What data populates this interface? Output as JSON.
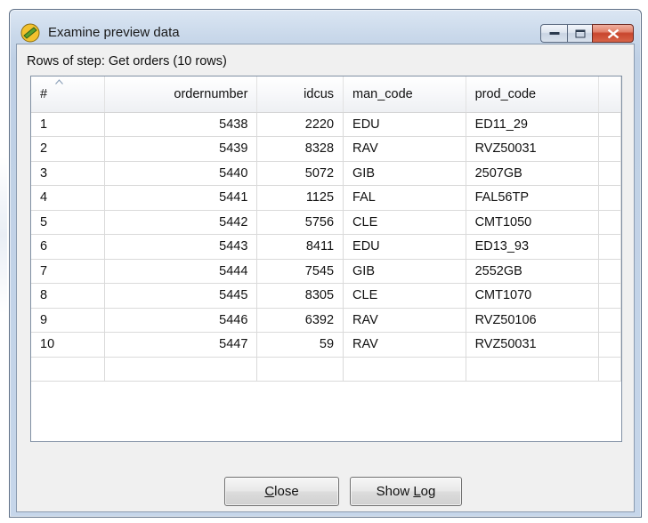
{
  "window": {
    "title": "Examine preview data",
    "icon": "kettle-spoon-icon"
  },
  "caption_buttons": [
    "minimize-icon",
    "maximize-icon",
    "close-icon"
  ],
  "rows_label": "Rows of step: Get orders (10 rows)",
  "table": {
    "columns": [
      "#",
      "ordernumber",
      "idcus",
      "man_code",
      "prod_code"
    ],
    "rows": [
      [
        "1",
        "5438",
        "2220",
        "EDU",
        "ED11_29"
      ],
      [
        "2",
        "5439",
        "8328",
        "RAV",
        "RVZ50031"
      ],
      [
        "3",
        "5440",
        "5072",
        "GIB",
        "2507GB"
      ],
      [
        "4",
        "5441",
        "1125",
        "FAL",
        "FAL56TP"
      ],
      [
        "5",
        "5442",
        "5756",
        "CLE",
        "CMT1050"
      ],
      [
        "6",
        "5443",
        "8411",
        "EDU",
        "ED13_93"
      ],
      [
        "7",
        "5444",
        "7545",
        "GIB",
        "2552GB"
      ],
      [
        "8",
        "5445",
        "8305",
        "CLE",
        "CMT1070"
      ],
      [
        "9",
        "5446",
        "6392",
        "RAV",
        "RVZ50106"
      ],
      [
        "10",
        "5447",
        "59",
        "RAV",
        "RVZ50031"
      ]
    ]
  },
  "buttons": {
    "close": {
      "mnemonic": "C",
      "rest": "lose"
    },
    "show_log": {
      "before": "Show ",
      "mnemonic": "L",
      "rest": "og"
    }
  },
  "colors": {
    "close_button": "#c8452d",
    "titlebar": "#c9d8ea"
  }
}
